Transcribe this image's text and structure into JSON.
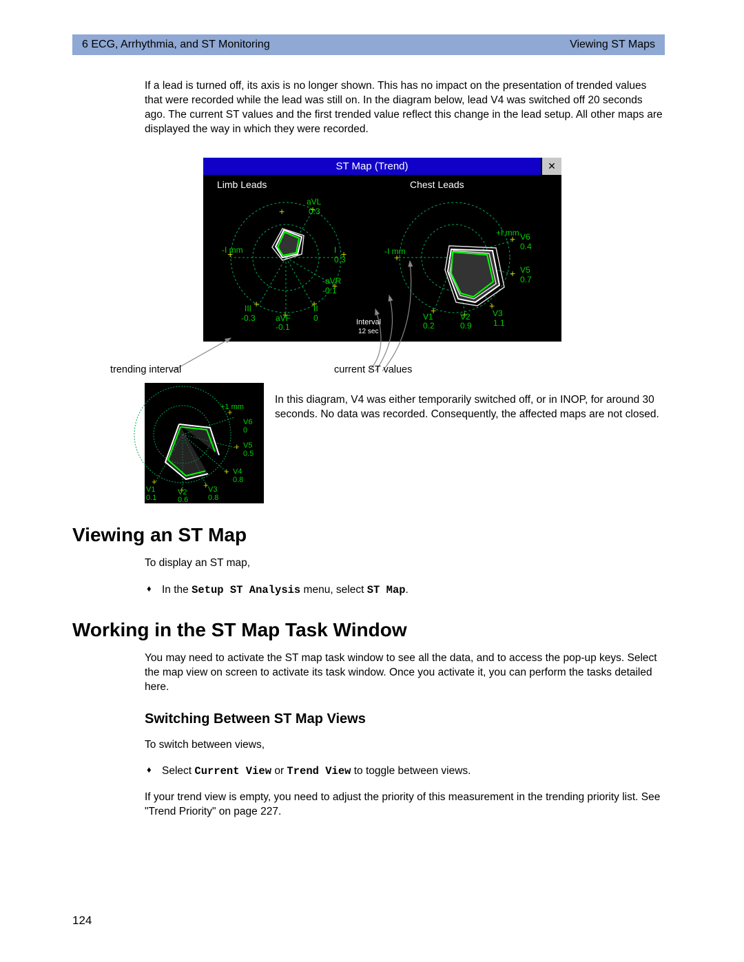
{
  "header": {
    "left": "6  ECG, Arrhythmia, and ST Monitoring",
    "right": "Viewing ST Maps"
  },
  "intro_para": "If a lead is turned off, its axis is no longer shown. This has no impact on the presentation of trended values that were recorded while the lead was still on. In the diagram below, lead V4 was switched off 20 seconds ago. The current ST values and the first trended value reflect this change in the lead setup. All other maps are displayed the way in which they were recorded.",
  "window": {
    "title": "ST Map (Trend)",
    "close": "✕",
    "limb_label": "Limb Leads",
    "chest_label": "Chest Leads",
    "interval_label": "Interval",
    "interval_value": "12 sec",
    "callout_left": "trending interval",
    "callout_right": "current ST values"
  },
  "chart_data": {
    "type": "polar-stmap",
    "panels": [
      {
        "name": "Limb Leads",
        "axes": [
          {
            "label": "aVL",
            "value": 0.3
          },
          {
            "label": "-I mm",
            "value": null
          },
          {
            "label": "I",
            "value": 0.3
          },
          {
            "label": "-aVR",
            "value": -0.1
          },
          {
            "label": "II",
            "value": 0.0
          },
          {
            "label": "aVF",
            "value": -0.1
          },
          {
            "label": "III",
            "value": -0.3
          }
        ],
        "tick_marks": true
      },
      {
        "name": "Chest Leads",
        "axes": [
          {
            "label": "+I mm",
            "value": null
          },
          {
            "label": "V6",
            "value": 0.4
          },
          {
            "label": "V5",
            "value": 0.7
          },
          {
            "label": "V3",
            "value": 1.1
          },
          {
            "label": "V2",
            "value": 0.9
          },
          {
            "label": "V1",
            "value": 0.2
          },
          {
            "label": "-I mm",
            "value": null
          }
        ],
        "tick_marks": true,
        "overlay_shapes": 4
      }
    ],
    "interval": "12 sec"
  },
  "mini_chart_data": {
    "type": "polar-stmap",
    "panel": {
      "axes": [
        {
          "label": "+1 mm",
          "value": null
        },
        {
          "label": "V6",
          "value": 0.0
        },
        {
          "label": "V5",
          "value": 0.5
        },
        {
          "label": "V4",
          "value": 0.8
        },
        {
          "label": "V3",
          "value": 0.8
        },
        {
          "label": "V2",
          "value": 0.6
        },
        {
          "label": "V1",
          "value": 0.1
        }
      ],
      "open_shape": true
    }
  },
  "mini_para": "In this diagram, V4 was either temporarily switched off, or in INOP, for around 30 seconds. No data was recorded. Consequently, the affected maps are not closed.",
  "h2_viewing": "Viewing an ST Map",
  "viewing_p1": "To display an ST map,",
  "viewing_bullet_prefix": "In the ",
  "viewing_bullet_mono1": "Setup ST Analysis",
  "viewing_bullet_mid": " menu, select ",
  "viewing_bullet_mono2": "ST Map",
  "viewing_bullet_suffix": ".",
  "h2_working": "Working in the ST Map Task Window",
  "working_p1": "You may need to activate the ST map task window to see all the data, and to access the pop-up keys. Select the map view on screen to activate its task window. Once you activate it, you can perform the tasks detailed here.",
  "h3_switch": "Switching Between ST Map Views",
  "switch_p1": "To switch between views,",
  "switch_bullet_prefix": "Select ",
  "switch_bullet_mono1": "Current View",
  "switch_bullet_mid": " or ",
  "switch_bullet_mono2": "Trend View",
  "switch_bullet_suffix": " to toggle between views.",
  "switch_p2": "If your trend view is empty, you need to adjust the priority of this measurement in the trending priority list. See \"Trend Priority\" on page 227.",
  "page_number": "124"
}
